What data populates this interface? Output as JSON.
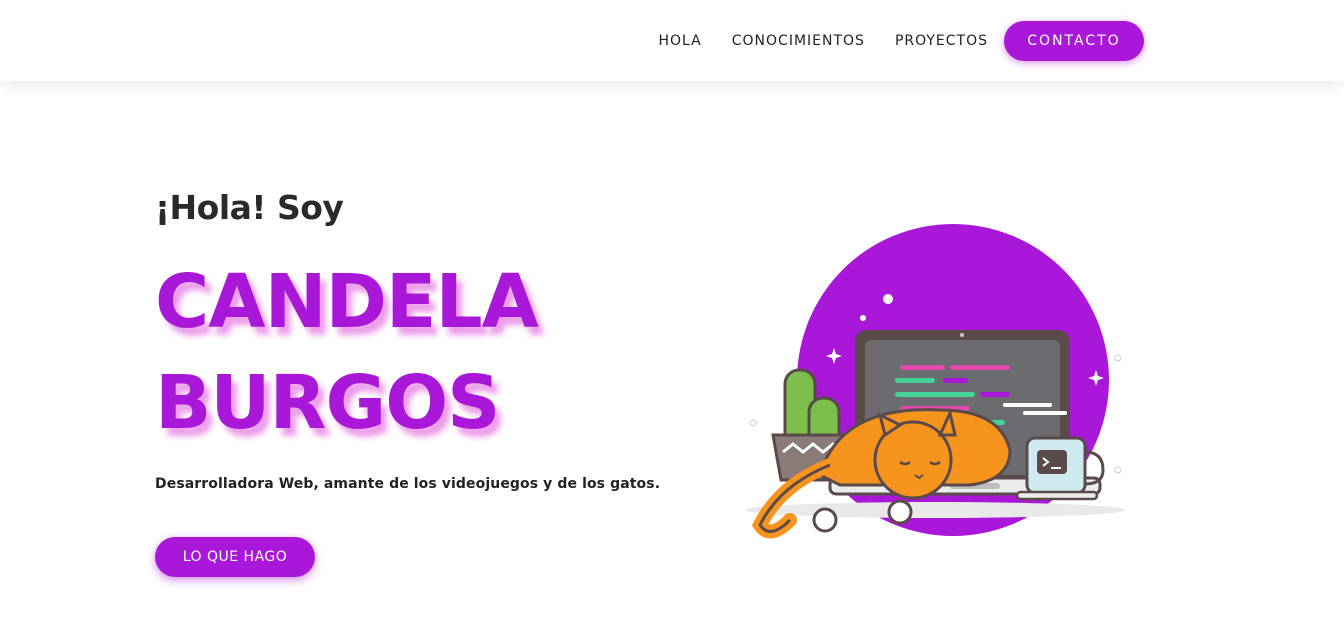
{
  "nav": {
    "links": [
      "HOLA",
      "CONOCIMIENTOS",
      "PROYECTOS"
    ],
    "contact_label": "CONTACTO"
  },
  "hero": {
    "greeting": "¡Hola! Soy",
    "name_line1": "CANDELA",
    "name_line2": "BURGOS",
    "tagline": "Desarrolladora Web, amante de los videojuegos y de los gatos.",
    "cta_label": "LO QUE HAGO"
  },
  "colors": {
    "accent": "#a918d9",
    "name_shadow": "#e98ce6",
    "cat_orange": "#f7941d",
    "cactus_green": "#7cc04b"
  },
  "illustration": {
    "icons": [
      "circle-background",
      "laptop-icon",
      "cat-icon",
      "cactus-icon",
      "mug-icon",
      "sparkle-icon"
    ]
  }
}
